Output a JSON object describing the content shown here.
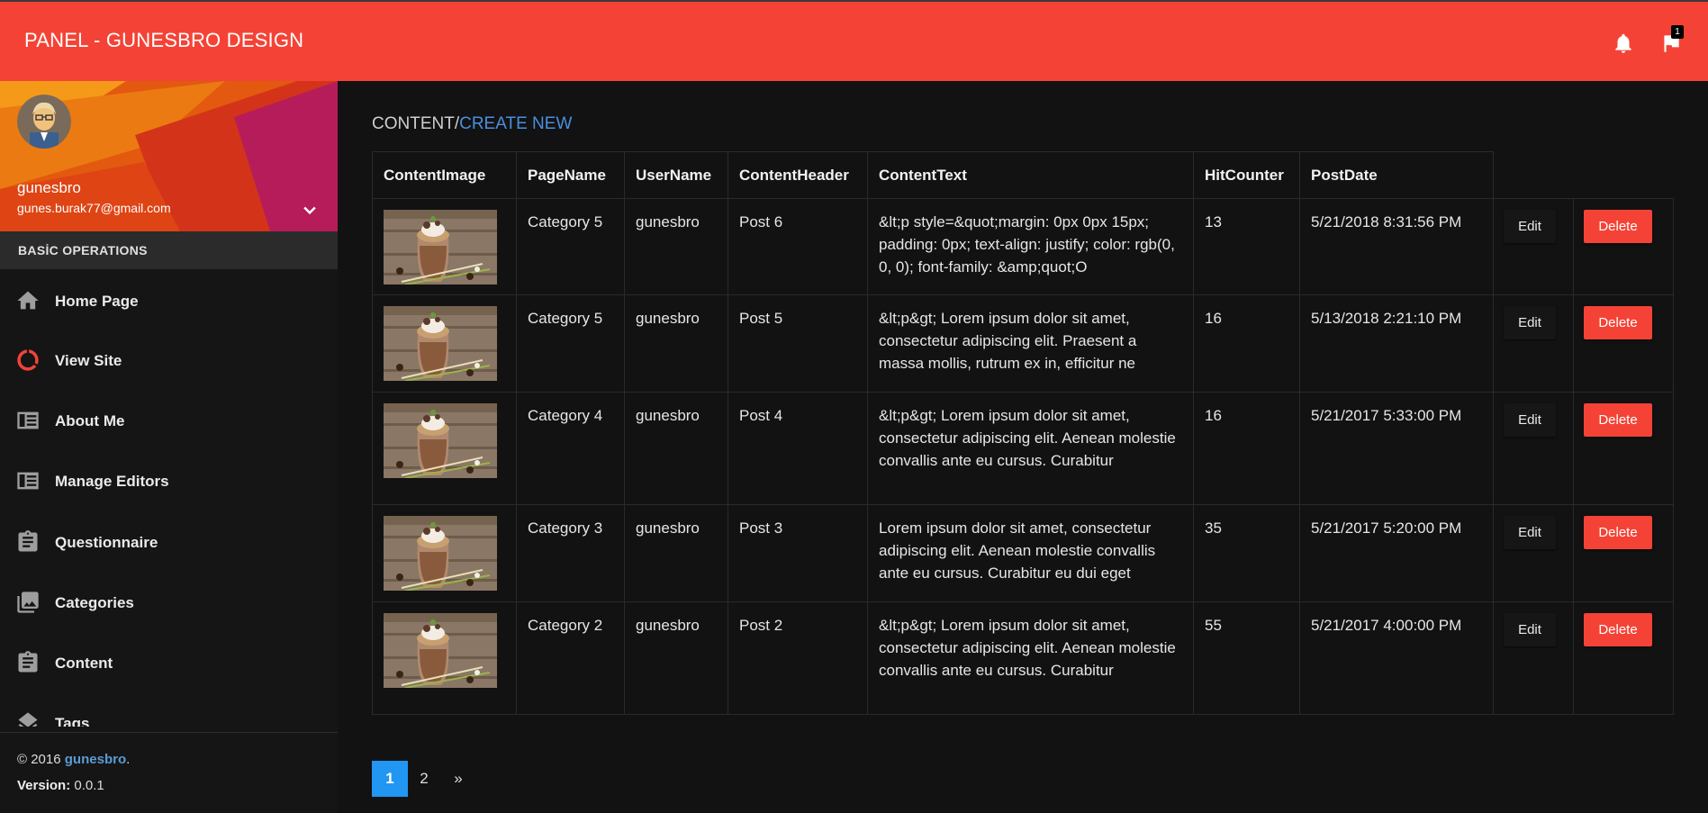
{
  "app": {
    "title": "PANEL - GUNESBRO DESIGN",
    "notification_count": "1"
  },
  "user": {
    "name": "gunesbro",
    "email": "gunes.burak77@gmail.com"
  },
  "sidebar": {
    "header": "BASİC OPERATIONS",
    "items": [
      {
        "label": "Home Page",
        "icon": "home-icon"
      },
      {
        "label": "View Site",
        "icon": "donut-icon"
      },
      {
        "label": "About Me",
        "icon": "view-list-icon"
      },
      {
        "label": "Manage Editors",
        "icon": "view-list-icon"
      },
      {
        "label": "Questionnaire",
        "icon": "clipboard-icon"
      },
      {
        "label": "Categories",
        "icon": "photo-library-icon"
      },
      {
        "label": "Content",
        "icon": "clipboard-icon"
      },
      {
        "label": "Tags",
        "icon": "layers-icon"
      }
    ],
    "footer": {
      "copyright_prefix": "© 2016 ",
      "copyright_link": "gunesbro",
      "copyright_suffix": ".",
      "version_label": "Version:",
      "version_value": " 0.0.1"
    }
  },
  "breadcrumb": {
    "current": "CONTENT/",
    "link": "CREATE NEW"
  },
  "table": {
    "columns": [
      "ContentImage",
      "PageName",
      "UserName",
      "ContentHeader",
      "ContentText",
      "HitCounter",
      "PostDate"
    ],
    "edit_label": "Edit",
    "delete_label": "Delete",
    "rows": [
      {
        "page": "Category 5",
        "user": "gunesbro",
        "header": "Post 6",
        "text": "&lt;p style=&quot;margin: 0px 0px 15px; padding: 0px; text-align: justify; color: rgb(0, 0, 0); font-family: &amp;quot;O",
        "hits": "13",
        "date": "5/21/2018 8:31:56 PM"
      },
      {
        "page": "Category 5",
        "user": "gunesbro",
        "header": "Post 5",
        "text": "&lt;p&gt; Lorem ipsum dolor sit amet, consectetur adipiscing elit. Praesent a massa mollis, rutrum ex in, efficitur ne",
        "hits": "16",
        "date": "5/13/2018 2:21:10 PM"
      },
      {
        "page": "Category 4",
        "user": "gunesbro",
        "header": "Post 4",
        "text": "&lt;p&gt; Lorem ipsum dolor sit amet, consectetur adipiscing elit. Aenean molestie convallis ante eu cursus. Curabitur",
        "hits": "16",
        "date": "5/21/2017 5:33:00 PM"
      },
      {
        "page": "Category 3",
        "user": "gunesbro",
        "header": "Post 3",
        "text": "Lorem ipsum dolor sit amet, consectetur adipiscing elit. Aenean molestie convallis ante eu cursus. Curabitur eu dui eget",
        "hits": "35",
        "date": "5/21/2017 5:20:00 PM"
      },
      {
        "page": "Category 2",
        "user": "gunesbro",
        "header": "Post 2",
        "text": "&lt;p&gt; Lorem ipsum dolor sit amet, consectetur adipiscing elit. Aenean molestie convallis ante eu cursus. Curabitur",
        "hits": "55",
        "date": "5/21/2017 4:00:00 PM"
      }
    ]
  },
  "pagination": {
    "pages": [
      "1",
      "2"
    ],
    "next": "»",
    "active": "1"
  },
  "colors": {
    "primary": "#f44336",
    "link": "#4a8fe0",
    "page_active": "#2196f3",
    "background": "#121212"
  }
}
